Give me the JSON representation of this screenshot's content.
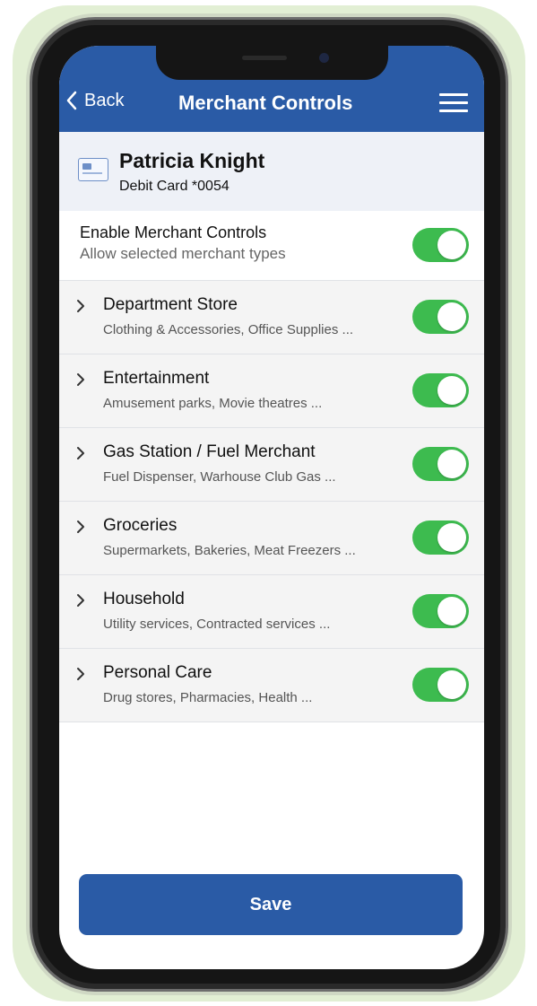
{
  "header": {
    "back_label": "Back",
    "title": "Merchant Controls",
    "back_icon": "chevron-left-icon",
    "menu_icon": "hamburger-menu-icon"
  },
  "card": {
    "holder_name": "Patricia Knight",
    "card_label": "Debit Card *0054",
    "icon": "credit-card-icon"
  },
  "master_control": {
    "title": "Enable Merchant Controls",
    "subtitle": "Allow selected merchant types",
    "enabled": true
  },
  "categories": [
    {
      "title": "Department Store",
      "subtitle": "Clothing & Accessories, Office Supplies ...",
      "enabled": true
    },
    {
      "title": "Entertainment",
      "subtitle": "Amusement parks, Movie theatres ...",
      "enabled": true
    },
    {
      "title": "Gas Station / Fuel Merchant",
      "subtitle": "Fuel Dispenser, Warhouse Club Gas ...",
      "enabled": true
    },
    {
      "title": "Groceries",
      "subtitle": "Supermarkets, Bakeries, Meat Freezers ...",
      "enabled": true
    },
    {
      "title": "Household",
      "subtitle": "Utility services, Contracted services ...",
      "enabled": true
    },
    {
      "title": "Personal Care",
      "subtitle": "Drug stores, Pharmacies, Health ...",
      "enabled": true
    }
  ],
  "save_label": "Save",
  "colors": {
    "brand_blue": "#2a5ba6",
    "toggle_on": "#3dbb4f",
    "background_glow": "#e2efd4"
  }
}
